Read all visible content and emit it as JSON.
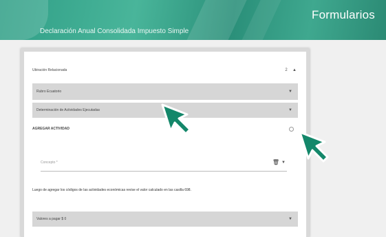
{
  "banner": {
    "title": "Formularios",
    "subtitle": "Declaración Anual Consolidada Impuesto Simple"
  },
  "form": {
    "row1": {
      "label": "Ubiración Relacionada",
      "count": "2",
      "chevron": "▲"
    },
    "row2": {
      "label": "Rubro Ecuatorio",
      "chevron": "▼"
    },
    "row3": {
      "label": "Determinación de Actividades Ejecutadas",
      "chevron": "▼"
    },
    "row4": {
      "label": "AGREGAR ACTIVIDAD"
    },
    "row5": {
      "placeholder": "Concepto *",
      "chevron": "▼"
    },
    "row6": {
      "text": "Luego de agregar los códigos de las actividades económicas revise el valor calculado en las casilla 698."
    },
    "row7": {
      "label": "Valores a pagar $ 0",
      "chevron": "▼"
    }
  },
  "colors": {
    "banner": "#2f9e86",
    "cursor": "#14876a"
  },
  "icons": {
    "trash": "trash-icon",
    "cursor": "pointer-arrow-icon"
  }
}
